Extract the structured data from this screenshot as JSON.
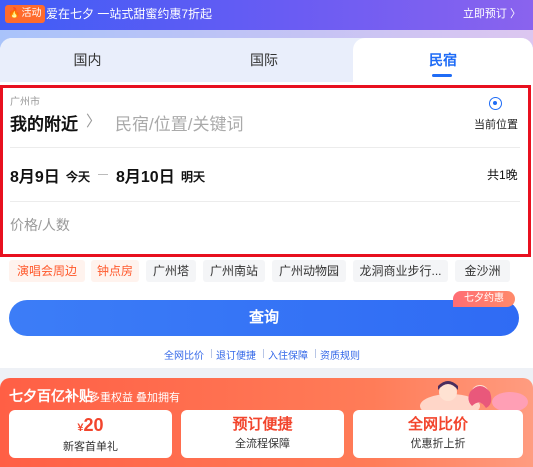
{
  "promo": {
    "badge": "活动",
    "text": "爱在七夕 一站式甜蜜约惠7折起",
    "link": "立即预订 〉"
  },
  "tabs": [
    {
      "label": "国内"
    },
    {
      "label": "国际"
    },
    {
      "label": "民宿",
      "active": true
    }
  ],
  "search": {
    "city": "广州市",
    "nearby": "我的附近",
    "keyword_placeholder": "民宿/位置/关键词",
    "current_location": "当前位置",
    "checkin_date": "8月9日",
    "checkin_day": "今天",
    "checkout_date": "8月10日",
    "checkout_day": "明天",
    "nights": "共1晚",
    "price_placeholder": "价格/人数"
  },
  "chips": [
    "演唱会周边",
    "钟点房",
    "广州塔",
    "广州南站",
    "广州动物园",
    "龙洞商业步行...",
    "金沙洲"
  ],
  "promo_tag": "七夕约惠",
  "search_button": "查询",
  "guarantees": [
    "全网比价",
    "退订便捷",
    "入住保障",
    "资质规则"
  ],
  "subsidy": {
    "title": "七夕百亿补贴",
    "subtitle": "多重权益 叠加拥有",
    "benefits": [
      {
        "currency": "¥",
        "main": "20",
        "sub": "新客首单礼"
      },
      {
        "main": "预订便捷",
        "sub": "全流程保障"
      },
      {
        "main": "全网比价",
        "sub": "优惠折上折"
      }
    ]
  },
  "colors": {
    "accent": "#1f6cf6",
    "highlight_border": "#e8101f",
    "promo_orange": "#ff5f45"
  }
}
